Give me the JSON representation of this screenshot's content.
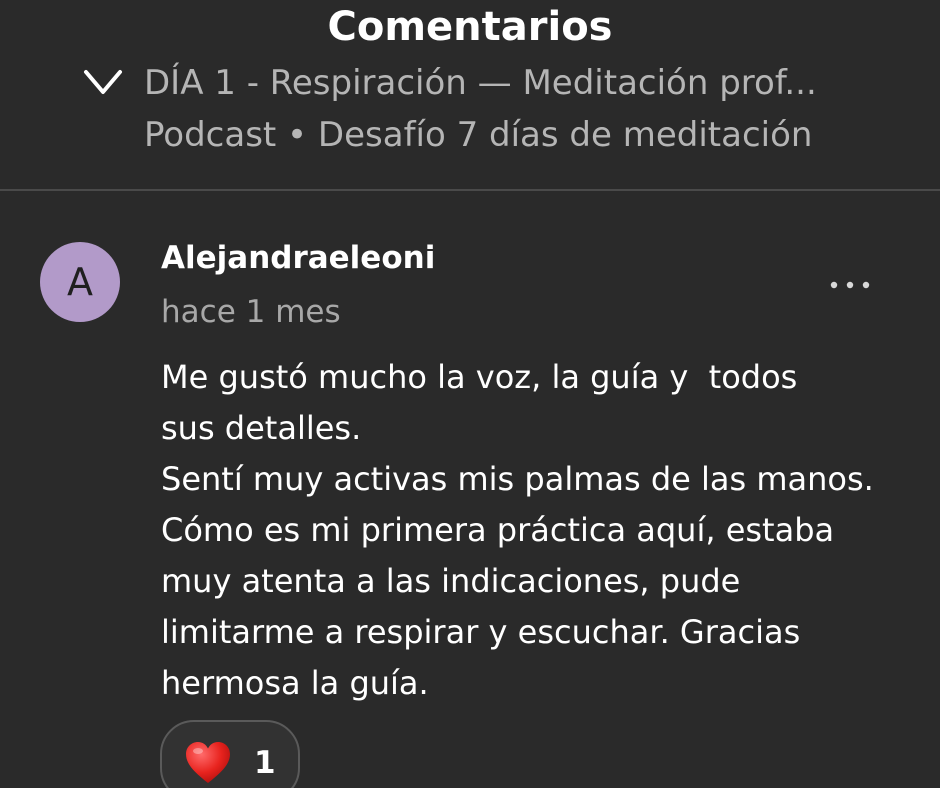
{
  "header": {
    "title": "Comentarios",
    "episode_title": "DÍA 1 - Respiración — Meditación prof...",
    "episode_subtitle": "Podcast • Desafío 7 días de meditación",
    "collapse_icon": "chevron-down-icon"
  },
  "comment": {
    "avatar_initial": "A",
    "avatar_color": "#b29ac9",
    "author": "Alejandraeleoni",
    "timestamp": "hace 1 mes",
    "more_icon": "more-horizontal-icon",
    "body_lines": [
      "Me gustó mucho la voz, la guía y  todos",
      "sus detalles.",
      "Sentí muy activas mis palmas de las manos.",
      "Cómo es mi primera práctica aquí, estaba",
      "muy atenta a las indicaciones, pude",
      "limitarme a respirar y escuchar. Gracias",
      "hermosa la guía."
    ],
    "reaction": {
      "icon": "heart-icon",
      "count": "1"
    }
  },
  "colors": {
    "background": "#2a2a2a",
    "secondary_text": "#b5b5b5",
    "divider": "#4a4a4a"
  }
}
